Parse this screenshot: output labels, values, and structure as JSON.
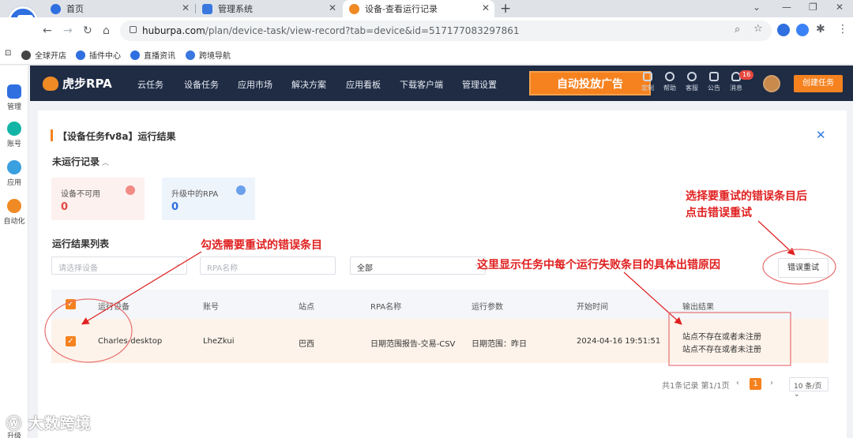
{
  "browser": {
    "tabs": [
      {
        "title": "首页",
        "active": false
      },
      {
        "title": "管理系统",
        "active": false
      },
      {
        "title": "设备-查看运行记录",
        "active": true
      }
    ],
    "url_host": "huburpa.com",
    "url_path": "/plan/device-task/view-record?tab=device&id=517177083297861",
    "bookmarks": [
      "全球开店",
      "插件中心",
      "直播资讯",
      "跨境导航"
    ]
  },
  "leftbar": {
    "items": [
      "管理",
      "账号",
      "应用",
      "自动化"
    ],
    "bottom": "升级"
  },
  "app": {
    "logo": "虎步RPA",
    "menu": [
      "云任务",
      "设备任务",
      "应用市场",
      "解决方案",
      "应用看板",
      "下载客户端",
      "管理设置"
    ],
    "promo": "自动投放广告",
    "header_icons": [
      "定制",
      "帮助",
      "客服",
      "公告",
      "消息"
    ],
    "message_count": "16",
    "create_button": "创建任务"
  },
  "page": {
    "title": "【设备任务fv8a】运行结果",
    "not_run_section": "未运行记录",
    "stats": [
      {
        "label": "设备不可用",
        "value": "0",
        "color": "#e5483f"
      },
      {
        "label": "升级中的RPA",
        "value": "0",
        "color": "#2f6fe0"
      }
    ],
    "list_section": "运行结果列表",
    "filters": {
      "device_placeholder": "请选择设备",
      "rpa_placeholder": "RPA名称",
      "status_value": "全部"
    },
    "retry_button": "错误重试",
    "columns": [
      "运行设备",
      "账号",
      "站点",
      "RPA名称",
      "运行参数",
      "开始时间",
      "输出结果"
    ],
    "rows": [
      {
        "device": "Charles-desktop",
        "account": "LheZkui",
        "site": "巴西",
        "rpa": "日期范围报告-交易-CSV",
        "params": "日期范围：昨日",
        "start_time": "2024-04-16 19:51:51",
        "output": [
          "站点不存在或者未注册",
          "站点不存在或者未注册"
        ]
      }
    ],
    "pagination": {
      "summary": "共1条记录 第1/1页",
      "current": "1",
      "page_size": "10 条/页"
    }
  },
  "annotations": {
    "select_rows": "勾选需要重试的错误条目",
    "retry_hint_line1": "选择要重试的错误条目后",
    "retry_hint_line2": "点击错误重试",
    "reason_hint": "这里显示任务中每个运行失败条目的具体出错原因"
  },
  "watermark": "大数跨境",
  "colors": {
    "brand": "#f5821f",
    "header": "#1f2c44",
    "annotation": "#e02020"
  }
}
